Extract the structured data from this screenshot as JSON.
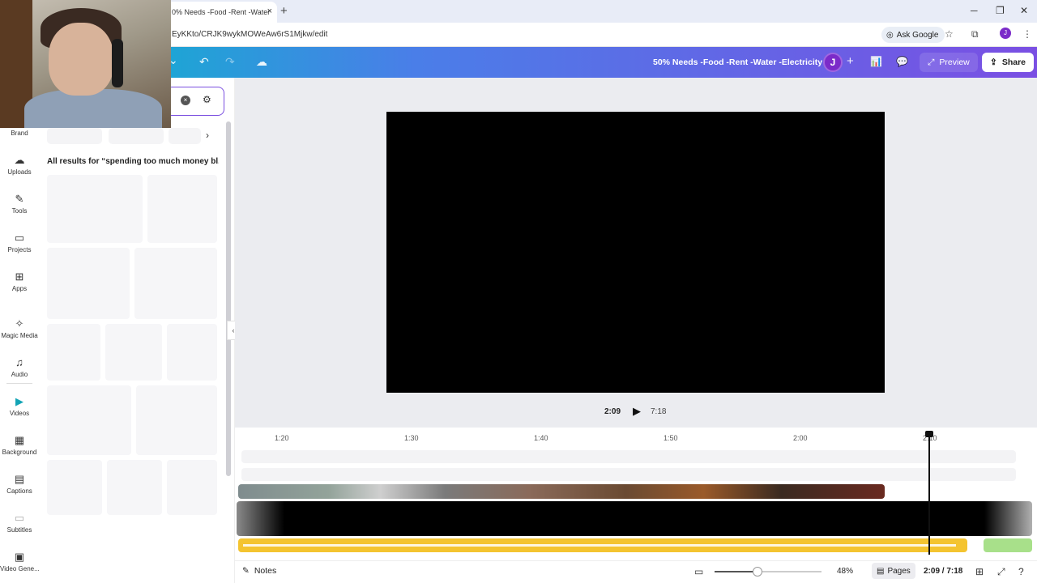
{
  "browser": {
    "tab_title": "0% Needs -Food -Rent -Water",
    "tab_close": "×",
    "new_tab": "+",
    "url": "EyKKto/CRJK9wykMOWeAw6rS1Mjkw/edit",
    "ask_google": "Ask Google",
    "profile_initial": "J",
    "window_controls": {
      "minimize": "─",
      "restore": "❐",
      "close": "✕"
    }
  },
  "header": {
    "doc_title": "50% Needs -Food -Rent -Water -Electricity",
    "avatar_initial": "J",
    "add": "+",
    "preview_label": "Preview",
    "share_label": "Share",
    "icons": {
      "undo": "↶",
      "redo": "↷",
      "cloud": "☁",
      "chart": "📊",
      "comment": "💬",
      "chevron": "⌄"
    }
  },
  "sidebar": {
    "items": [
      {
        "label": "Brand",
        "icon": ""
      },
      {
        "label": "Uploads",
        "icon": "☁"
      },
      {
        "label": "Tools",
        "icon": "✎"
      },
      {
        "label": "Projects",
        "icon": "▭"
      },
      {
        "label": "Apps",
        "icon": "⊞"
      },
      {
        "label": "Magic Media",
        "icon": "✧"
      },
      {
        "label": "Audio",
        "icon": "♫"
      },
      {
        "label": "Videos",
        "icon": "▶"
      },
      {
        "label": "Background",
        "icon": "▦"
      },
      {
        "label": "Captions",
        "icon": "▤"
      },
      {
        "label": "Subtitles",
        "icon": "▭"
      },
      {
        "label": "Video Gene...",
        "icon": "▣"
      }
    ]
  },
  "panel": {
    "results_title": "All results for “spending too much money bl...",
    "clear_icon": "×",
    "filter_icon": "⚙",
    "chevron": "›",
    "collapse": "‹"
  },
  "player": {
    "current_time": "2:09",
    "total_time": "7:18"
  },
  "timeline": {
    "ticks": [
      "1:20",
      "1:30",
      "1:40",
      "1:50",
      "2:00",
      "2:10"
    ]
  },
  "footer": {
    "notes_label": "Notes",
    "zoom_percent": "48%",
    "zoom_fraction": 0.48,
    "pages_label": "Pages",
    "time_readout": "2:09 / 7:18"
  }
}
